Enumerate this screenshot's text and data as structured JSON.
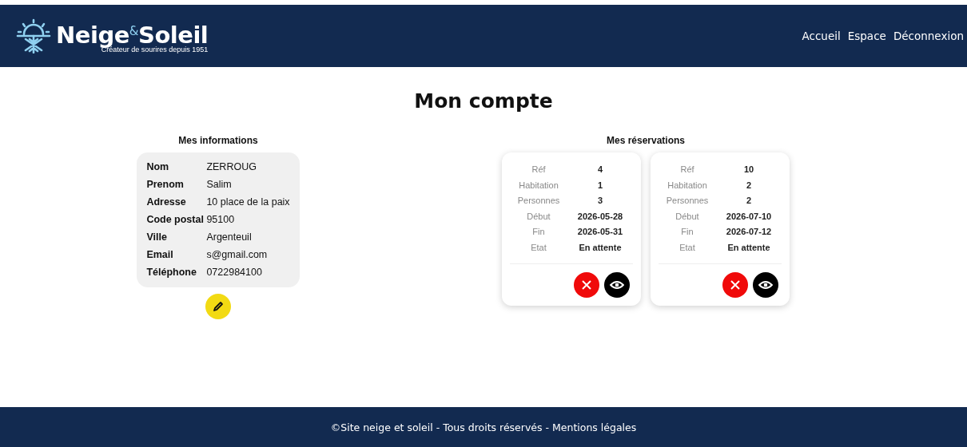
{
  "header": {
    "logo": {
      "name": "Neige$^{&}$Soleil",
      "tagline": "Créateur de sourires depuis 1951"
    },
    "nav": [
      "Accueil",
      "Espace",
      "Déconnexion"
    ]
  },
  "page_title": "Mon compte",
  "info": {
    "title": "Mes informations",
    "fields": [
      {
        "label": "Nom",
        "value": "ZERROUG"
      },
      {
        "label": "Prenom",
        "value": "Salim"
      },
      {
        "label": "Adresse",
        "value": "10 place de la paix"
      },
      {
        "label": "Code postal",
        "value": "95100"
      },
      {
        "label": "Ville",
        "value": "Argenteuil"
      },
      {
        "label": "Email",
        "value": "s@gmail.com"
      },
      {
        "label": "Téléphone",
        "value": "0722984100"
      }
    ]
  },
  "reservations": {
    "title": "Mes réservations",
    "items": [
      {
        "rows": [
          {
            "label": "Réf",
            "value": "4"
          },
          {
            "label": "Habitation",
            "value": "1"
          },
          {
            "label": "Personnes",
            "value": "3"
          },
          {
            "label": "Début",
            "value": "2026-05-28"
          },
          {
            "label": "Fin",
            "value": "2026-05-31"
          },
          {
            "label": "Etat",
            "value": "En attente"
          }
        ]
      },
      {
        "rows": [
          {
            "label": "Réf",
            "value": "10"
          },
          {
            "label": "Habitation",
            "value": "2"
          },
          {
            "label": "Personnes",
            "value": "2"
          },
          {
            "label": "Début",
            "value": "2026-07-10"
          },
          {
            "label": "Fin",
            "value": "2026-07-12"
          },
          {
            "label": "Etat",
            "value": "En attente"
          }
        ]
      }
    ]
  },
  "footer": "©Site neige et soleil - Tous droits réservés - Mentions légales"
}
